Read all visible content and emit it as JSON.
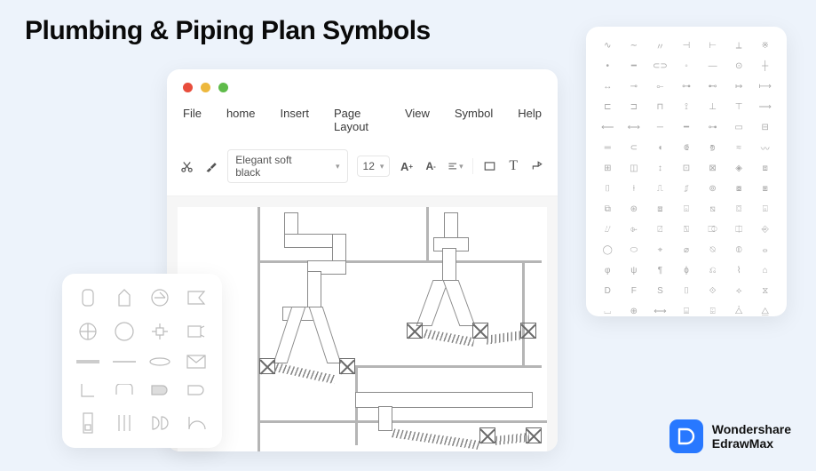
{
  "page": {
    "title": "Plumbing & Piping Plan Symbols"
  },
  "menubar": {
    "items": [
      "File",
      "home",
      "Insert",
      "Page Layout",
      "View",
      "Symbol",
      "Help"
    ]
  },
  "toolbar": {
    "font": "Elegant soft black",
    "fontSize": "12",
    "tools": {
      "cut": "cut-icon",
      "brush": "format-brush-icon",
      "increaseFont": "A+",
      "decreaseFont": "A-",
      "align": "align-icon",
      "rect": "rect-tool",
      "text": "T",
      "connector": "connector-tool"
    }
  },
  "leftPanel": {
    "shapes": [
      "cylinder",
      "tank",
      "circle-valve",
      "flag",
      "rot-circle",
      "big-circle",
      "node",
      "box-conn",
      "hbar",
      "hslim",
      "lens",
      "mail",
      "bracket",
      "cap",
      "bullet",
      "bullet2",
      "vrect",
      "bars",
      "dd",
      "arc"
    ]
  },
  "rightPanel": {
    "rows": 14,
    "cols": 7
  },
  "brand": {
    "top": "Wondershare",
    "bot": "EdrawMax"
  }
}
